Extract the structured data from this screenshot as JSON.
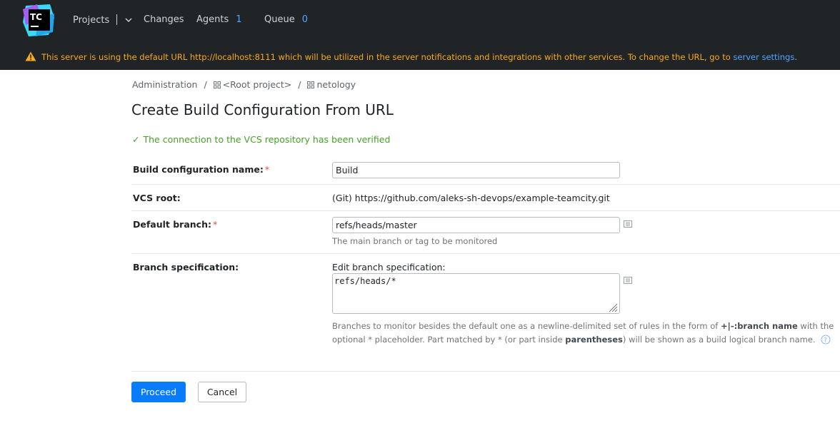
{
  "header": {
    "logo_text": "TC",
    "nav": {
      "projects": "Projects",
      "changes": "Changes",
      "agents": "Agents",
      "agents_count": "1",
      "queue": "Queue",
      "queue_count": "0"
    },
    "warning": {
      "text": "This server is using the default URL http://localhost:8111 which will be utilized in the server notifications and integrations with other services. To change the URL, go to",
      "link": "server settings",
      "suffix": "."
    }
  },
  "breadcrumb": {
    "items": [
      "Administration",
      "<Root project>",
      "netology"
    ],
    "separator": "/"
  },
  "page": {
    "title": "Create Build Configuration From URL",
    "success_message": "The connection to the VCS repository has been verified"
  },
  "form": {
    "build_name": {
      "label": "Build configuration name:",
      "required_mark": "*",
      "value": "Build"
    },
    "vcs_root": {
      "label": "VCS root:",
      "value": "(Git) https://github.com/aleks-sh-devops/example-teamcity.git"
    },
    "default_branch": {
      "label": "Default branch:",
      "required_mark": "*",
      "value": "refs/heads/master",
      "hint": "The main branch or tag to be monitored"
    },
    "branch_spec": {
      "label": "Branch specification:",
      "edit_label": "Edit branch specification:",
      "value": "refs/heads/*",
      "help_1a": "Branches to monitor besides the default one as a newline-delimited set of rules in the form of ",
      "help_1b": "+|-:branch name",
      "help_1c": " with the",
      "help_2a": "optional * placeholder. Part matched by * (or part inside ",
      "help_2b": "parentheses",
      "help_2c": ") will be shown as a build logical branch name."
    }
  },
  "buttons": {
    "proceed": "Proceed",
    "cancel": "Cancel"
  },
  "colors": {
    "header_bg": "#212426",
    "warning_text": "#f7a81e",
    "link": "#4fa6ff",
    "success": "#44a125",
    "primary_button": "#087cfa",
    "required": "#e04d4d"
  }
}
